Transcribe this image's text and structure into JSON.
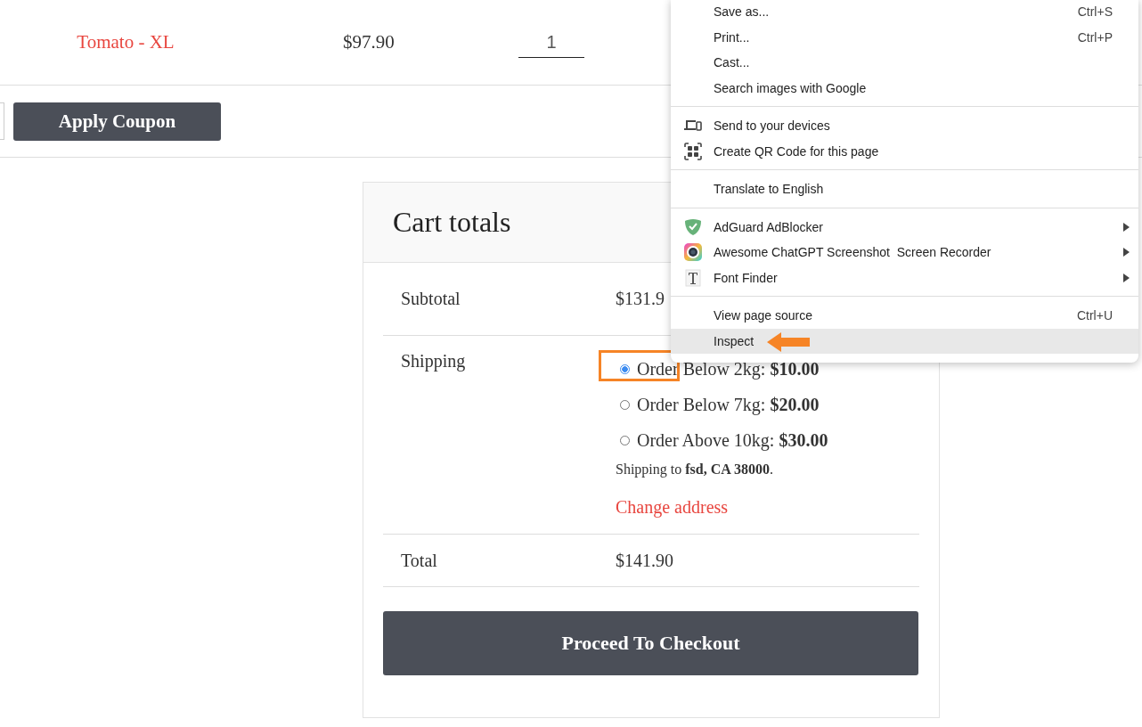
{
  "cart_item": {
    "name": "Tomato - XL",
    "price": "$97.90",
    "quantity": "1"
  },
  "coupon": {
    "button": "Apply Coupon"
  },
  "cart_totals": {
    "title": "Cart totals",
    "subtotal": {
      "label": "Subtotal",
      "value": "$131.9"
    },
    "shipping": {
      "label": "Shipping",
      "options": [
        {
          "name": "Order Below 2kg: ",
          "price": "$10.00",
          "selected": true
        },
        {
          "name": "Order Below 7kg: ",
          "price": "$20.00",
          "selected": false
        },
        {
          "name": "Order Above 10kg: ",
          "price": "$30.00",
          "selected": false
        }
      ],
      "destination": "Shipping to **fsd, CA 38000**.",
      "change_link": "Change address"
    },
    "total": {
      "label": "Total",
      "value": "$141.90"
    },
    "checkout_button": "Proceed To Checkout"
  },
  "context_menu": {
    "groups": [
      [
        {
          "label": "Save as...",
          "shortcut": "Ctrl+S",
          "submenu": false,
          "selected": false
        },
        {
          "label": "Print...",
          "shortcut": "Ctrl+P",
          "submenu": false,
          "selected": false
        },
        {
          "label": "Cast...",
          "submenu": false,
          "selected": false
        },
        {
          "label": "Search images with Google",
          "submenu": false,
          "selected": false
        }
      ],
      [
        {
          "label": "Send to your devices",
          "kind": "devices",
          "submenu": false,
          "selected": false
        },
        {
          "label": "Create QR Code for this page",
          "kind": "qr",
          "submenu": false,
          "selected": false
        }
      ],
      [
        {
          "label": "Translate to English",
          "submenu": false,
          "selected": false
        }
      ],
      [
        {
          "label": "AdGuard AdBlocker",
          "kind": "shield",
          "submenu": true,
          "selected": false
        },
        {
          "label": "Awesome ChatGPT Screenshot  Screen Recorder",
          "kind": "lens",
          "submenu": true,
          "selected": false
        },
        {
          "label": "Font Finder",
          "kind": "font",
          "submenu": true,
          "selected": false
        }
      ],
      [
        {
          "label": "View page source",
          "shortcut": "Ctrl+U",
          "submenu": false,
          "selected": false
        },
        {
          "label": "Inspect",
          "submenu": false,
          "selected": true
        }
      ]
    ]
  }
}
